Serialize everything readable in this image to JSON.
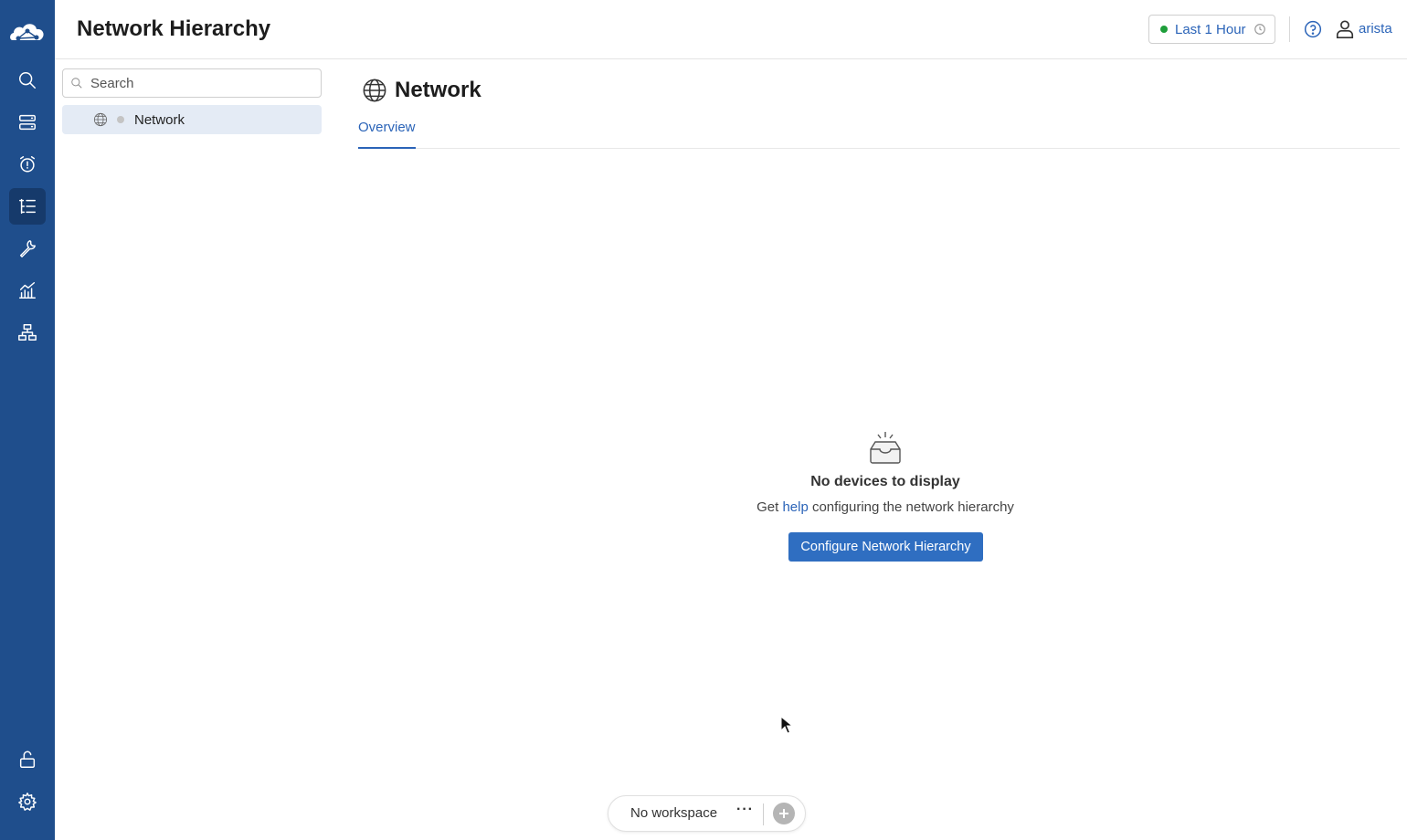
{
  "app": {
    "page_title": "Network Hierarchy",
    "accent_color": "#2b64b8",
    "sidebar_color": "#1f4e8c"
  },
  "sidebar": {
    "items": [
      {
        "icon": "search-icon"
      },
      {
        "icon": "devices-icon"
      },
      {
        "icon": "events-alarm-icon"
      },
      {
        "icon": "hierarchy-list-icon",
        "active": true
      },
      {
        "icon": "wrench-icon"
      },
      {
        "icon": "dashboard-chart-icon"
      },
      {
        "icon": "topology-icon"
      }
    ],
    "bottom": [
      {
        "icon": "unlock-icon"
      },
      {
        "icon": "settings-gear-icon"
      }
    ]
  },
  "header": {
    "time_range": "Last 1 Hour",
    "user": "arista"
  },
  "tree": {
    "search_placeholder": "Search",
    "items": [
      {
        "label": "Network",
        "icon": "globe-icon"
      }
    ]
  },
  "main": {
    "title": "Network",
    "tabs": [
      {
        "label": "Overview",
        "active": true
      }
    ],
    "empty_state": {
      "title": "No devices to display",
      "sub_prefix": "Get ",
      "sub_link": "help",
      "sub_suffix": " configuring the network hierarchy",
      "button": "Configure Network Hierarchy"
    }
  },
  "workspace": {
    "label": "No workspace",
    "more": "···"
  }
}
